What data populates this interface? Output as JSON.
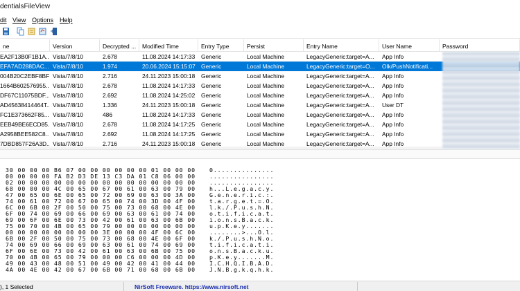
{
  "window": {
    "title": "dentialsFileView"
  },
  "menu": [
    {
      "label": "dit",
      "underline_index": 0
    },
    {
      "label": "View",
      "underline_index": 0
    },
    {
      "label": "Options",
      "underline_index": 0
    },
    {
      "label": "Help",
      "underline_index": 0
    }
  ],
  "toolbar": {
    "buttons": [
      {
        "icon": "save-icon",
        "color": "#2d6bb5"
      },
      {
        "icon": "copy-icon",
        "color": "#4a8fd4"
      },
      {
        "icon": "properties-icon",
        "color": "#c59a2b"
      },
      {
        "icon": "refresh-icon",
        "color": "#3b7fc8"
      },
      {
        "icon": "exit-icon",
        "color": "#2b5ea0"
      }
    ]
  },
  "columns": [
    "ne",
    "Version",
    "Decrypted ...",
    "Modified Time",
    "Entry Type",
    "Persist",
    "Entry Name",
    "User Name",
    "Password"
  ],
  "rows": [
    {
      "name": "EA2F13B0F1B1A...",
      "version": "Vista/7/8/10",
      "size": "2.678",
      "modified": "11.08.2024 14:17:33",
      "type": "Generic",
      "persist": "Local Machine",
      "entry": "LegacyGeneric:target=A...",
      "user": "App Info",
      "selected": false
    },
    {
      "name": "EFA7AD288DAC...",
      "version": "Vista/7/8/10",
      "size": "1.974",
      "modified": "20.06.2024 15:15:07",
      "type": "Generic",
      "persist": "Local Machine",
      "entry": "LegacyGeneric:target=O...",
      "user": "Olk/PushNotificati...",
      "selected": true
    },
    {
      "name": "004B20C2EBF8BF...",
      "version": "Vista/7/8/10",
      "size": "2.716",
      "modified": "24.11.2023 15:00:18",
      "type": "Generic",
      "persist": "Local Machine",
      "entry": "LegacyGeneric:target=A...",
      "user": "App Info",
      "selected": false
    },
    {
      "name": "1664B602576955...",
      "version": "Vista/7/8/10",
      "size": "2.678",
      "modified": "11.08.2024 14:17:33",
      "type": "Generic",
      "persist": "Local Machine",
      "entry": "LegacyGeneric:target=A...",
      "user": "App Info",
      "selected": false
    },
    {
      "name": "DF67C11075BDF...",
      "version": "Vista/7/8/10",
      "size": "2.692",
      "modified": "11.08.2024 14:25:02",
      "type": "Generic",
      "persist": "Local Machine",
      "entry": "LegacyGeneric:target=A...",
      "user": "App Info",
      "selected": false
    },
    {
      "name": "AD45638414464T...",
      "version": "Vista/7/8/10",
      "size": "1.336",
      "modified": "24.11.2023 15:00:18",
      "type": "Generic",
      "persist": "Local Machine",
      "entry": "LegacyGeneric:target=A...",
      "user": "User DT",
      "selected": false
    },
    {
      "name": "FC1E373662F85...",
      "version": "Vista/7/8/10",
      "size": "486",
      "modified": "11.08.2024 14:17:33",
      "type": "Generic",
      "persist": "Local Machine",
      "entry": "LegacyGeneric:target=A...",
      "user": "App Info",
      "selected": false
    },
    {
      "name": "EEB49BE6ECD85...",
      "version": "Vista/7/8/10",
      "size": "2.678",
      "modified": "11.08.2024 14:17:25",
      "type": "Generic",
      "persist": "Local Machine",
      "entry": "LegacyGeneric:target=A...",
      "user": "App Info",
      "selected": false
    },
    {
      "name": "A2958BEE582C8...",
      "version": "Vista/7/8/10",
      "size": "2.692",
      "modified": "11.08.2024 14:17:25",
      "type": "Generic",
      "persist": "Local Machine",
      "entry": "LegacyGeneric:target=A...",
      "user": "App Info",
      "selected": false
    },
    {
      "name": "7DBD857F26A3D...",
      "version": "Vista/7/8/10",
      "size": "2.716",
      "modified": "24.11.2023 15:00:18",
      "type": "Generic",
      "persist": "Local Machine",
      "entry": "LegacyGeneric:target=A...",
      "user": "App Info",
      "selected": false
    }
  ],
  "hex": {
    "lines": [
      "30 00 00 00 B6 07 00 00 00 00 00 00 01 00 00 00",
      "00 00 00 00 FA B2 D3 DE 13 C3 DA 01 C8 06 00 00",
      "02 00 00 00 00 00 00 00 00 00 00 00 00 00 00 00",
      "68 00 00 00 4C 00 65 00 67 00 61 00 63 00 79 00",
      "47 00 65 00 6E 00 65 00 72 00 69 00 63 00 3A 00",
      "74 00 61 00 72 00 67 00 65 00 74 00 3D 00 4F 00",
      "6C 00 6B 00 2F 00 50 00 75 00 73 00 68 00 4E 00",
      "6F 00 74 00 69 00 66 00 69 00 63 00 61 00 74 00",
      "69 00 6F 00 6E 00 73 00 42 00 61 00 63 00 6B 00",
      "75 00 70 00 4B 00 65 00 79 00 00 00 00 00 00 00",
      "00 00 00 00 00 00 00 00 3E 00 00 00 4F 00 6C 00",
      "6B 00 2F 00 50 00 75 00 73 00 68 00 4E 00 6F 00",
      "74 00 69 00 66 00 69 00 63 00 61 00 74 00 69 00",
      "6F 00 6E 00 73 00 42 00 61 00 63 00 6B 00 75 00",
      "70 00 4B 00 65 00 79 00 00 00 C6 00 00 00 4D 00",
      "49 00 43 00 48 00 51 00 49 00 42 00 41 00 44 00",
      "4A 00 4E 00 42 00 67 00 6B 00 71 00 68 00 6B 00"
    ],
    "ascii": [
      "0...............",
      "................",
      "................",
      "h...L.e.g.a.c.y.",
      "G.e.n.e.r.i.c.:.",
      "t.a.r.g.e.t.=.O.",
      "l.k./.P.u.s.h.N.",
      "o.t.i.f.i.c.a.t.",
      "i.o.n.s.B.a.c.k.",
      "u.p.K.e.y.......",
      "........>...O.l.",
      "k./.P.u.s.h.N.o.",
      "t.i.f.i.c.a.t.i.",
      "o.n.s.B.a.c.k.u.",
      "p.K.e.y.......M.",
      "I.C.H.Q.I.B.A.D.",
      "J.N.B.g.k.q.h.k."
    ]
  },
  "status": {
    "left": "), 1 Selected",
    "link": "NirSoft Freeware. https://www.nirsoft.net"
  },
  "colors": {
    "selection": "#0078d7",
    "link": "#1a2fb0"
  }
}
